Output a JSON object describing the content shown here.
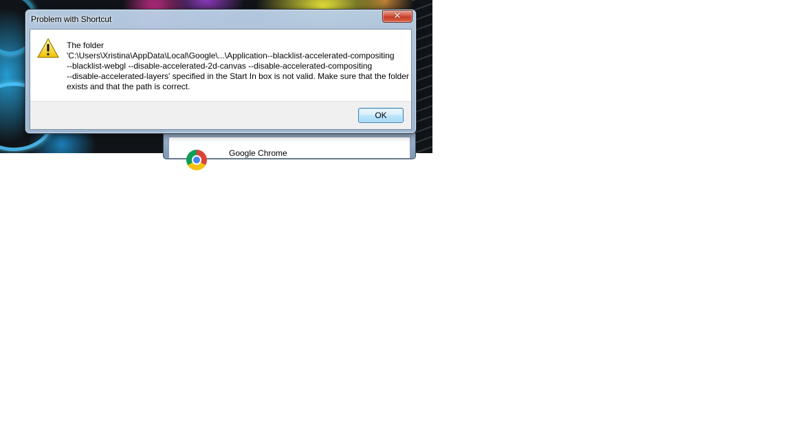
{
  "dialog": {
    "title": "Problem with Shortcut",
    "message_lines": [
      "The folder",
      "'C:\\Users\\Xristina\\AppData\\Local\\Google\\...\\Application--blacklist-accelerated-compositing",
      "--blacklist-webgl --disable-accelerated-2d-canvas --disable-accelerated-compositing",
      "--disable-accelerated-layers' specified in the Start In box is not valid. Make sure that the folder",
      "exists and that the path is correct."
    ],
    "ok_label": "OK",
    "close_symbol": "✕",
    "icon": "warning-icon"
  },
  "background_window": {
    "app_label": "Google Chrome",
    "icon": "chrome-icon"
  }
}
